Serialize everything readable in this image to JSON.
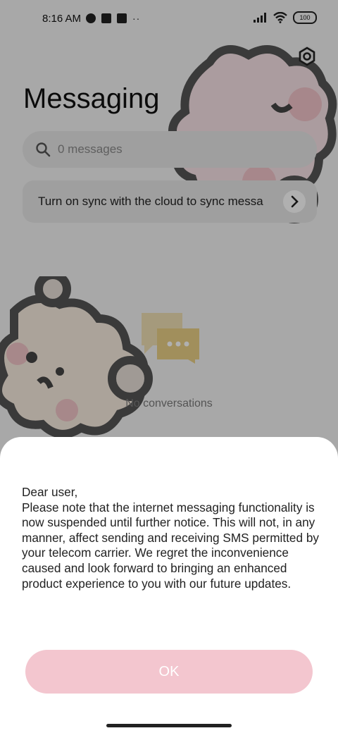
{
  "status_bar": {
    "time": "8:16 AM",
    "battery": "100",
    "icons": [
      "shield-icon",
      "square-icon",
      "upload-icon",
      "more-dots-icon",
      "signal-icon",
      "wifi-icon",
      "battery-icon"
    ]
  },
  "header": {
    "title": "Messaging",
    "settings_icon": "gear-icon"
  },
  "search": {
    "placeholder": "0 messages"
  },
  "sync_banner": {
    "text": "Turn on sync with the cloud to sync messa",
    "arrow_icon": "chevron-right-icon"
  },
  "empty_state": {
    "text": "No conversations",
    "icon": "chat-bubbles-icon"
  },
  "dialog": {
    "lines": [
      "Dear user,",
      "Please note that the internet messaging functionality is now suspended until further notice. This will not, in any manner, affect sending and receiving SMS permitted by your telecom carrier. We regret the inconvenience caused and look forward to bringing an enhanced product experience to you with our future updates."
    ],
    "ok_label": "OK"
  },
  "colors": {
    "accent_pink": "#f3c6cf",
    "overlay": "rgba(0,0,0,0.31)"
  }
}
